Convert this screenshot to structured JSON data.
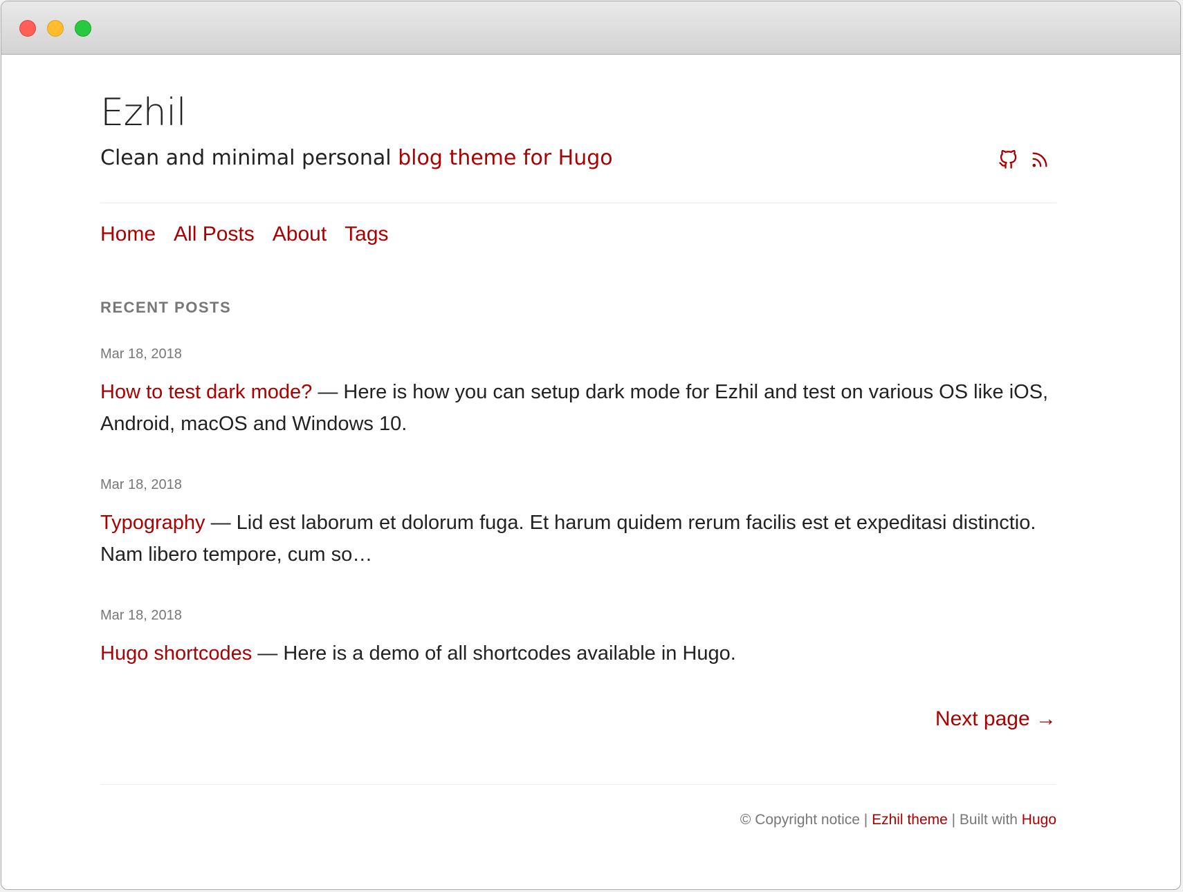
{
  "site": {
    "title": "Ezhil",
    "subtitle_part1": "Clean and minimal personal ",
    "subtitle_part2": "blog theme for Hugo"
  },
  "social": {
    "icons": [
      "github-icon",
      "rss-icon"
    ]
  },
  "nav": {
    "items": [
      {
        "label": "Home"
      },
      {
        "label": "All Posts"
      },
      {
        "label": "About"
      },
      {
        "label": "Tags"
      }
    ]
  },
  "recent": {
    "heading": "RECENT POSTS",
    "separator": " — ",
    "posts": [
      {
        "date": "Mar 18, 2018",
        "title": "How to test dark mode?",
        "summary": "Here is how you can setup dark mode for Ezhil and test on various OS like iOS, Android, macOS and Windows 10."
      },
      {
        "date": "Mar 18, 2018",
        "title": "Typography",
        "summary": "Lid est laborum et dolorum fuga. Et harum quidem rerum facilis est et expeditasi distinctio. Nam libero tempore, cum so…"
      },
      {
        "date": "Mar 18, 2018",
        "title": "Hugo shortcodes",
        "summary": "Here is a demo of all shortcodes available in Hugo."
      }
    ]
  },
  "pagination": {
    "next_label": "Next page →"
  },
  "footer": {
    "copyright": "© Copyright notice",
    "sep1": " | ",
    "theme_link": "Ezhil theme",
    "built_text": " | Built with ",
    "hugo_link": "Hugo"
  },
  "colors": {
    "accent": "#aa0000",
    "text": "#222222",
    "muted": "#777777",
    "rule": "#ebebeb"
  }
}
